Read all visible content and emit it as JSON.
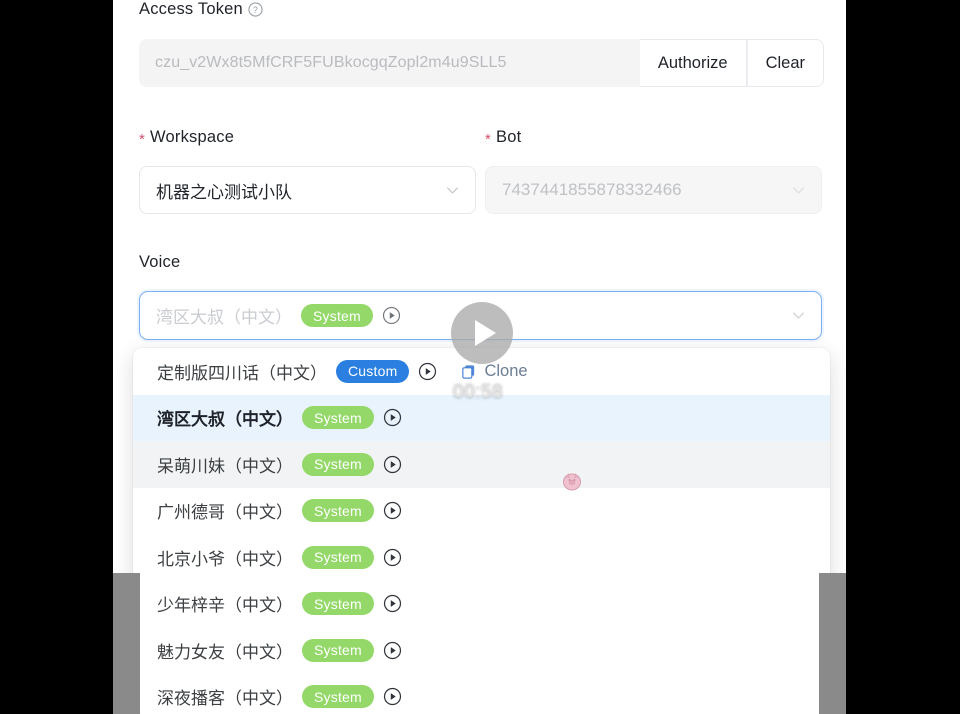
{
  "form": {
    "access_token": {
      "label": "Access Token",
      "help_icon": "question-circle-icon",
      "value": "",
      "placeholder": "czu_v2Wx8t5MfCRF5FUBkocgqZopl2m4u9SLL5",
      "authorize_label": "Authorize",
      "clear_label": "Clear"
    },
    "workspace": {
      "label": "Workspace",
      "required_mark": "*",
      "value": "机器之心测试小队",
      "chevron": "chevron-down-icon"
    },
    "bot": {
      "label": "Bot",
      "required_mark": "*",
      "value": "7437441855878332466",
      "disabled": true,
      "chevron": "chevron-down-icon"
    },
    "voice": {
      "label": "Voice",
      "value": "湾区大叔（中文）",
      "badge": "System",
      "play_icon": "play-circle-icon",
      "chevron": "chevron-down-icon"
    }
  },
  "voice_dropdown": {
    "clone_label": "Clone",
    "clone_icon": "copy-icon",
    "options": [
      {
        "name": "定制版四川话（中文）",
        "badge": "Custom",
        "badge_type": "custom",
        "has_clone": true,
        "state": "normal"
      },
      {
        "name": "湾区大叔（中文）",
        "badge": "System",
        "badge_type": "system",
        "has_clone": false,
        "state": "selected"
      },
      {
        "name": "呆萌川妹（中文）",
        "badge": "System",
        "badge_type": "system",
        "has_clone": false,
        "state": "hovered"
      },
      {
        "name": "广州德哥（中文）",
        "badge": "System",
        "badge_type": "system",
        "has_clone": false,
        "state": "normal"
      },
      {
        "name": "北京小爷（中文）",
        "badge": "System",
        "badge_type": "system",
        "has_clone": false,
        "state": "normal"
      },
      {
        "name": "少年梓辛（中文）",
        "badge": "System",
        "badge_type": "system",
        "has_clone": false,
        "state": "normal"
      },
      {
        "name": "魅力女友（中文）",
        "badge": "System",
        "badge_type": "system",
        "has_clone": false,
        "state": "normal"
      },
      {
        "name": "深夜播客（中文）",
        "badge": "System",
        "badge_type": "system",
        "has_clone": false,
        "state": "normal"
      }
    ]
  },
  "video_overlay": {
    "play_icon": "play-triangle-icon",
    "timestamp": "00:58"
  },
  "cursor": {
    "icon": "pink-pig-cursor-icon"
  },
  "colors": {
    "badge_system": "#93d868",
    "badge_custom": "#2b7fe0",
    "focus_border": "#7eb0f0",
    "selected_row": "#e8f3fd",
    "clone_text": "#6b7d96",
    "required_star": "#d4526e"
  }
}
